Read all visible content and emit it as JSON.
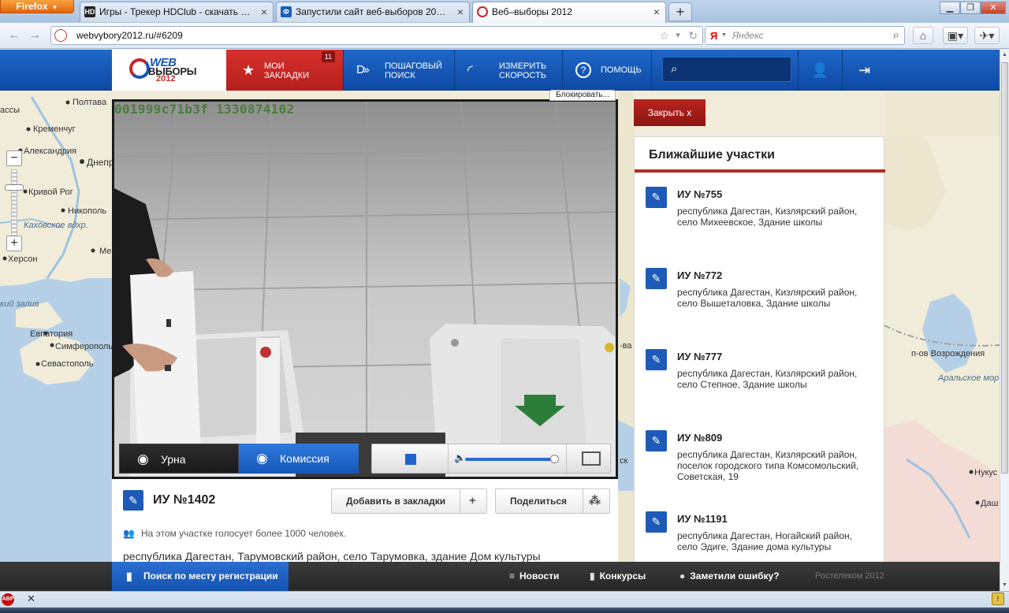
{
  "browser": {
    "menu_label": "Firefox",
    "tabs": [
      {
        "title": "Игры - Трекер HDClub - скачать бе...",
        "fav": "HD",
        "color": "#222222"
      },
      {
        "title": "Запустили сайт веб-выборов 2012 -...",
        "fav": "Ф",
        "color": "#1b5fb7"
      },
      {
        "title": "Веб–выборы 2012",
        "fav": "",
        "color": "#c8242b"
      }
    ],
    "url": "webvybory2012.ru/#6209",
    "search_engine": "Я",
    "search_placeholder": "Яндекс"
  },
  "site": {
    "logo": {
      "line1": "WEB",
      "line2": "ВЫБОРЫ",
      "line3": "2012"
    },
    "nav": {
      "bookmarks": "МОИ\nЗАКЛАДКИ",
      "bookmarks_count": "11",
      "search": "ПОШАГОВЫЙ\nПОИСК",
      "speed": "ИЗМЕРИТЬ\nСКОРОСТЬ",
      "help": "ПОМОЩЬ"
    }
  },
  "map": {
    "labels": [
      {
        "text": "Полтава"
      },
      {
        "text": "ассы"
      },
      {
        "text": "Кременчуг"
      },
      {
        "text": "Александрия"
      },
      {
        "text": "Днепр"
      },
      {
        "text": "Кривой Рог"
      },
      {
        "text": "Никополь"
      },
      {
        "text": "Каховское вдхр."
      },
      {
        "text": "Ме"
      },
      {
        "text": "Херсон"
      },
      {
        "text": "кий залив"
      },
      {
        "text": "Евпатория"
      },
      {
        "text": "Симферополь"
      },
      {
        "text": "Севастополь"
      },
      {
        "text": "-ва"
      },
      {
        "text": "ск"
      },
      {
        "text": "п-ов Возрождения"
      },
      {
        "text": "Аральское мор"
      },
      {
        "text": "Нукус"
      },
      {
        "text": "Даш"
      }
    ]
  },
  "video": {
    "block_label": "Блокировать...",
    "camera_id": "001999c71b3f 1330874102",
    "tabs": {
      "urn": "Урна",
      "commission": "Комиссия"
    },
    "volume": 0.93
  },
  "station": {
    "title": "ИУ №1402",
    "bookmark_btn": "Добавить в закладки",
    "share_btn": "Поделиться",
    "voters_note": "На этом участке голосует более 1000 человек.",
    "address": "республика Дагестан, Тарумовский район, село Тарумовка, здание Дом культуры"
  },
  "close_btn": "Закрыть  x",
  "nearby": {
    "title": "Ближайшие участки",
    "items": [
      {
        "title": "ИУ №755",
        "address": "республика Дагестан, Кизлярский район, село Михеевское, Здание школы"
      },
      {
        "title": "ИУ №772",
        "address": "республика Дагестан, Кизлярский район, село Вышеталовка, Здание школы"
      },
      {
        "title": "ИУ №777",
        "address": "республика Дагестан, Кизлярский район, село Степное, Здание школы"
      },
      {
        "title": "ИУ №809",
        "address": "республика Дагестан, Кизлярский район, поселок городского типа Комсомольский, Советская, 19"
      },
      {
        "title": "ИУ №1191",
        "address": "республика Дагестан, Ногайский район, село Эдиге, Здание дома культуры"
      }
    ]
  },
  "footer": {
    "search_reg": "Поиск по месту регистрации",
    "news": "Новости",
    "contests": "Конкурсы",
    "error": "Заметили ошибку?",
    "copyright": "Ростелеком 2012"
  },
  "statusbar": {
    "abp": "ABP"
  }
}
